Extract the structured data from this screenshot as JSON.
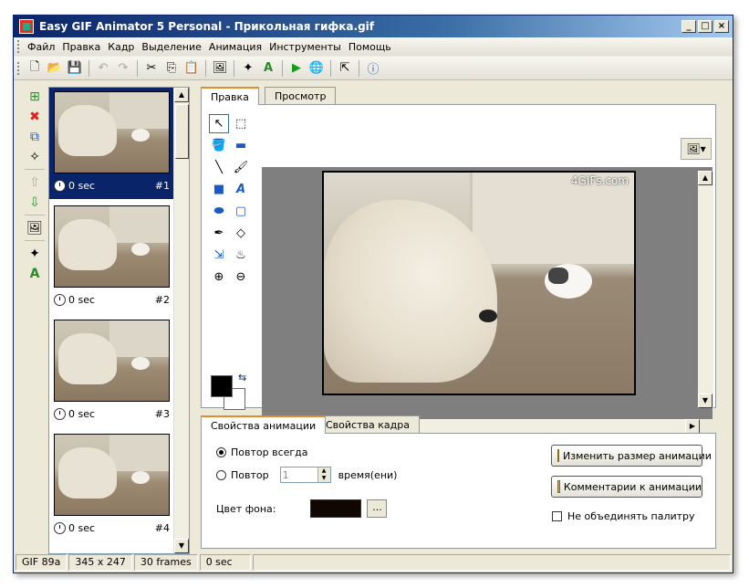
{
  "window": {
    "title": "Easy GIF Animator 5 Personal - Прикольная гифка.gif"
  },
  "menu": [
    "Файл",
    "Правка",
    "Кадр",
    "Выделение",
    "Анимация",
    "Инструменты",
    "Помощь"
  ],
  "frames": [
    {
      "time": "0 sec",
      "num": "#1"
    },
    {
      "time": "0 sec",
      "num": "#2"
    },
    {
      "time": "0 sec",
      "num": "#3"
    },
    {
      "time": "0 sec",
      "num": "#4"
    }
  ],
  "edit_tabs": {
    "edit": "Правка",
    "preview": "Просмотр"
  },
  "canvas": {
    "watermark": "4GIFs.com"
  },
  "prop_tabs": {
    "animation": "Свойства анимации",
    "frame": "Свойства кадра"
  },
  "props": {
    "repeat_always": "Повтор всегда",
    "repeat": "Повтор",
    "repeat_count": "1",
    "times": "время(ени)",
    "bg_color_label": "Цвет фона:",
    "bg_color": "#100800",
    "dots": "...",
    "resize_btn": "Изменить размер анимации",
    "comments_btn": "Комментарии к анимации",
    "no_merge": "Не объединять палитру"
  },
  "status": {
    "format": "GIF 89a",
    "size": "345 x 247",
    "frames": "30 frames",
    "time": "0 sec"
  }
}
